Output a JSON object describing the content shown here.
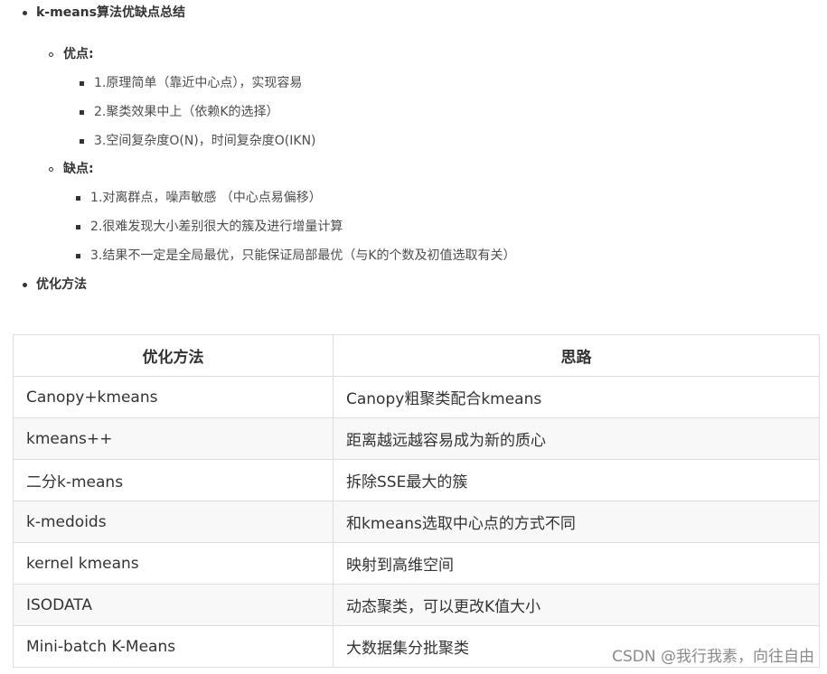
{
  "section1": {
    "heading": "k-means算法优缺点总结",
    "pros": {
      "label": "优点:",
      "items": [
        "1.原理简单（靠近中心点），实现容易",
        "2.聚类效果中上（依赖K的选择）",
        "3.空间复杂度O(N)，时间复杂度O(IKN)"
      ]
    },
    "cons": {
      "label": "缺点:",
      "items": [
        "1.对离群点，噪声敏感 （中心点易偏移）",
        "2.很难发现大小差别很大的簇及进行增量计算",
        "3.结果不一定是全局最优，只能保证局部最优（与K的个数及初值选取有关）"
      ]
    }
  },
  "section2": {
    "heading": "优化方法"
  },
  "table": {
    "headers": [
      "优化方法",
      "思路"
    ],
    "rows": [
      [
        "Canopy+kmeans",
        "Canopy粗聚类配合kmeans"
      ],
      [
        "kmeans++",
        "距离越远越容易成为新的质心"
      ],
      [
        "二分k-means",
        "拆除SSE最大的簇"
      ],
      [
        "k-medoids",
        "和kmeans选取中心点的方式不同"
      ],
      [
        "kernel kmeans",
        "映射到高维空间"
      ],
      [
        "ISODATA",
        "动态聚类，可以更改K值大小"
      ],
      [
        "Mini-batch K-Means",
        "大数据集分批聚类"
      ]
    ]
  },
  "watermark": "CSDN @我行我素，向往自由"
}
